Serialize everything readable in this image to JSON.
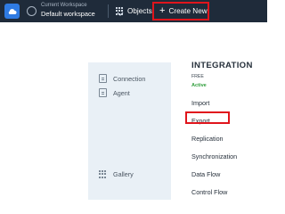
{
  "topbar": {
    "workspace_caption": "Current Workspace",
    "workspace_name": "Default workspace",
    "objects_label": "Objects",
    "create_new_label": "Create New"
  },
  "palette": {
    "items": [
      "Connection",
      "Agent"
    ],
    "gallery_label": "Gallery"
  },
  "menu": {
    "title": "INTEGRATION",
    "plan": "FREE",
    "status": "Active",
    "items": [
      "Import",
      "Export",
      "Replication",
      "Synchronization",
      "Data Flow",
      "Control Flow"
    ]
  },
  "colors": {
    "topbar": "#1f2b3a",
    "brand": "#2f7be3",
    "highlight": "#e0151c",
    "palette": "#e9f0f6",
    "active": "#2e9d3a"
  }
}
